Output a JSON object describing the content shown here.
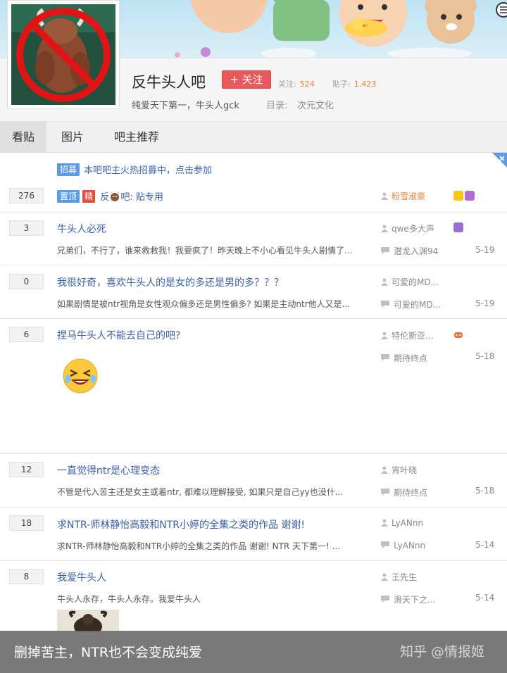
{
  "forum": {
    "name": "反牛头人吧",
    "follow_label": "+ 关注",
    "follow_count_label": "关注:",
    "follow_count": "524",
    "post_count_label": "贴子:",
    "post_count": "1,423",
    "slogan": "纯爱天下第一，牛头人gck",
    "directory_label": "目录:",
    "directory_value": "次元文化"
  },
  "tabs": [
    "看贴",
    "图片",
    "吧主推荐"
  ],
  "recruit": {
    "tag": "招募",
    "text": "本吧吧主火热招募中，点击参加"
  },
  "posts": [
    {
      "replies": "276",
      "tags": [
        "置顶",
        "精"
      ],
      "title_before": "反",
      "title_after": "吧: 贴专用",
      "author": "粉雪淑豪",
      "badge_colors": [
        "#f5c518",
        "#b56bd6"
      ]
    },
    {
      "replies": "3",
      "title": "牛头人必死",
      "excerpt": "兄弟们，不行了，谁来救救我！我要疯了！昨天晚上不小心看见牛头人剧情了...",
      "author": "qwe多大声",
      "last_reply": "潜龙入渊94",
      "date": "5-19"
    },
    {
      "replies": "0",
      "title": "我很好奇，喜欢牛头人的是女的多还是男的多？？？",
      "excerpt": "如果剧情是被ntr视角是女性观众偏多还是男性偏多? 如果是主动ntr他人又是...",
      "author": "可爱的MD...",
      "last_reply": "可爱的MD...",
      "date": "5-19"
    },
    {
      "replies": "6",
      "title": "捏马牛头人不能去自己的吧?",
      "author": "特伦斯亚...",
      "last_reply": "期待终点",
      "date": "5-18"
    },
    {
      "replies": "12",
      "title": "一直觉得ntr是心理变态",
      "excerpt": "不管是代入苦主还是女主或着ntr, 都难以理解接受, 如果只是自己yy也没什...",
      "author": "宵叶晓",
      "last_reply": "期待终点",
      "date": "5-18"
    },
    {
      "replies": "18",
      "title": "求NTR-师林静怡高毅和NTR小婷的全集之类的作品 谢谢!",
      "excerpt": "求NTR-师林静怡高毅和NTR小婷的全集之类的作品 谢谢! NTR 天下第一! ...",
      "author": "LyANnn",
      "last_reply": "LyANnn",
      "date": "5-14"
    },
    {
      "replies": "8",
      "title": "我爱牛头人",
      "excerpt": "牛头人永存，牛头人永存。我爱牛头人",
      "author": "王先生",
      "last_reply": "滑天下之...",
      "date": "5-14"
    }
  ],
  "caption": {
    "text": "删掉苦主，NTR也不会变成纯爱",
    "watermark": "知乎 @情报姬"
  },
  "colors": {
    "follow_button": "#e85a5a",
    "link_blue": "#3a5fa8",
    "count_orange": "#f07a3a",
    "tag_blue": "#5b9be3",
    "tag_red": "#e74c3c"
  }
}
